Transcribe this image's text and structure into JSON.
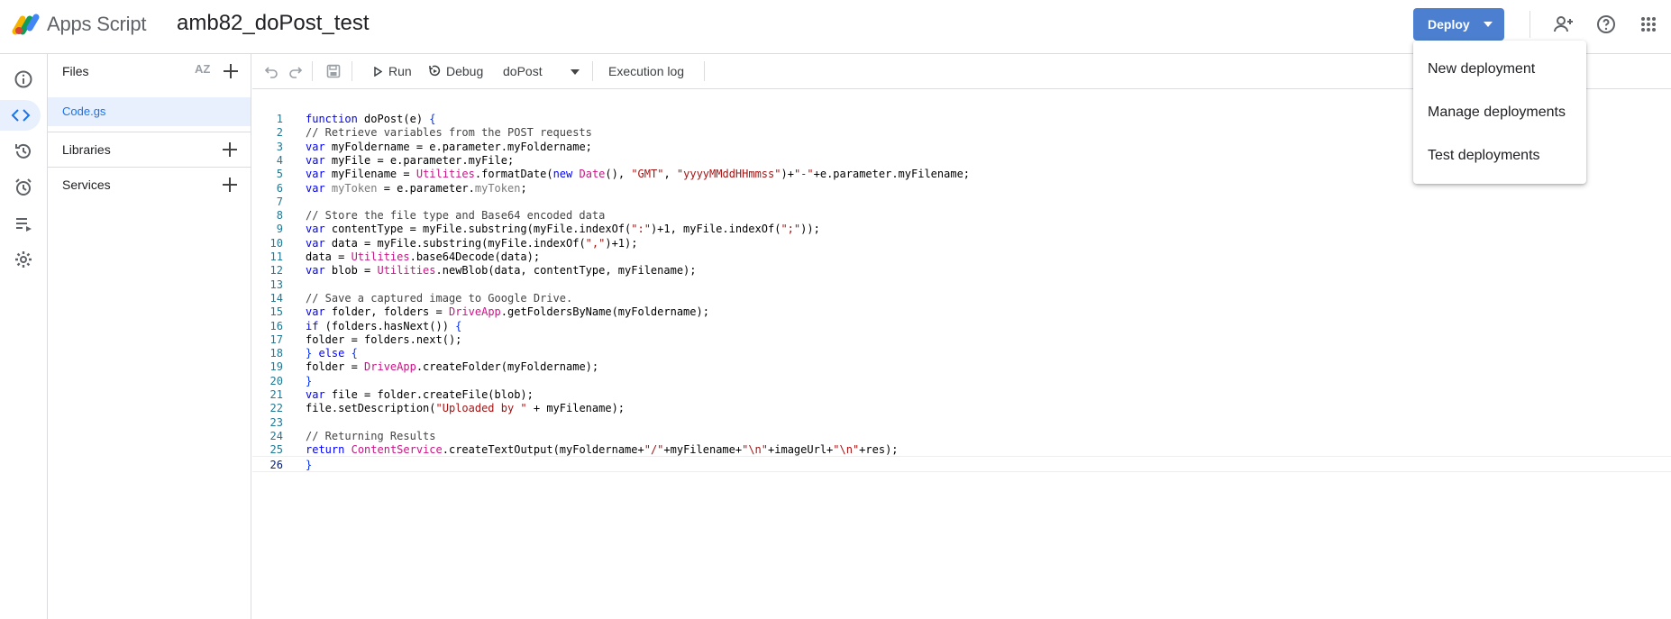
{
  "header": {
    "app_name": "Apps Script",
    "project_title": "amb82_doPost_test",
    "deploy_label": "Deploy",
    "icons": [
      "add-person-icon",
      "help-icon",
      "apps-grid-icon"
    ]
  },
  "deploy_menu": {
    "items": [
      "New deployment",
      "Manage deployments",
      "Test deployments"
    ]
  },
  "rail": {
    "icons": [
      "info-icon",
      "code-icon",
      "history-icon",
      "triggers-icon",
      "executions-icon",
      "settings-icon"
    ],
    "active": "code-icon"
  },
  "files_panel": {
    "title": "Files",
    "sort_label": "AZ",
    "file": "Code.gs",
    "libraries_label": "Libraries",
    "services_label": "Services"
  },
  "toolbar": {
    "run_label": "Run",
    "debug_label": "Debug",
    "function_select": "doPost",
    "execution_log_label": "Execution log"
  },
  "code": {
    "lines": [
      "function doPost(e) {",
      "// Retrieve variables from the POST requests",
      "var myFoldername = e.parameter.myFoldername;",
      "var myFile = e.parameter.myFile;",
      "var myFilename = Utilities.formatDate(new Date(), \"GMT\", \"yyyyMMddHHmmss\")+\"-\"+e.parameter.myFilename;",
      "var myToken = e.parameter.myToken;",
      "",
      "// Store the file type and Base64 encoded data",
      "var contentType = myFile.substring(myFile.indexOf(\":\")+1, myFile.indexOf(\";\"));",
      "var data = myFile.substring(myFile.indexOf(\",\")+1);",
      "data = Utilities.base64Decode(data);",
      "var blob = Utilities.newBlob(data, contentType, myFilename);",
      "",
      "// Save a captured image to Google Drive.",
      "var folder, folders = DriveApp.getFoldersByName(myFoldername);",
      "if (folders.hasNext()) {",
      "folder = folders.next();",
      "} else {",
      "folder = DriveApp.createFolder(myFoldername);",
      "}",
      "var file = folder.createFile(blob);",
      "file.setDescription(\"Uploaded by \" + myFilename);",
      "",
      "// Returning Results",
      "return ContentService.createTextOutput(myFoldername+\"/\"+myFilename+\"\\n\"+imageUrl+\"\\n\"+res);",
      "}"
    ],
    "current_line": 26
  },
  "colors": {
    "accent": "#4c7fcf",
    "active_bg": "#e8f0fe",
    "active_text": "#1a73e8"
  }
}
